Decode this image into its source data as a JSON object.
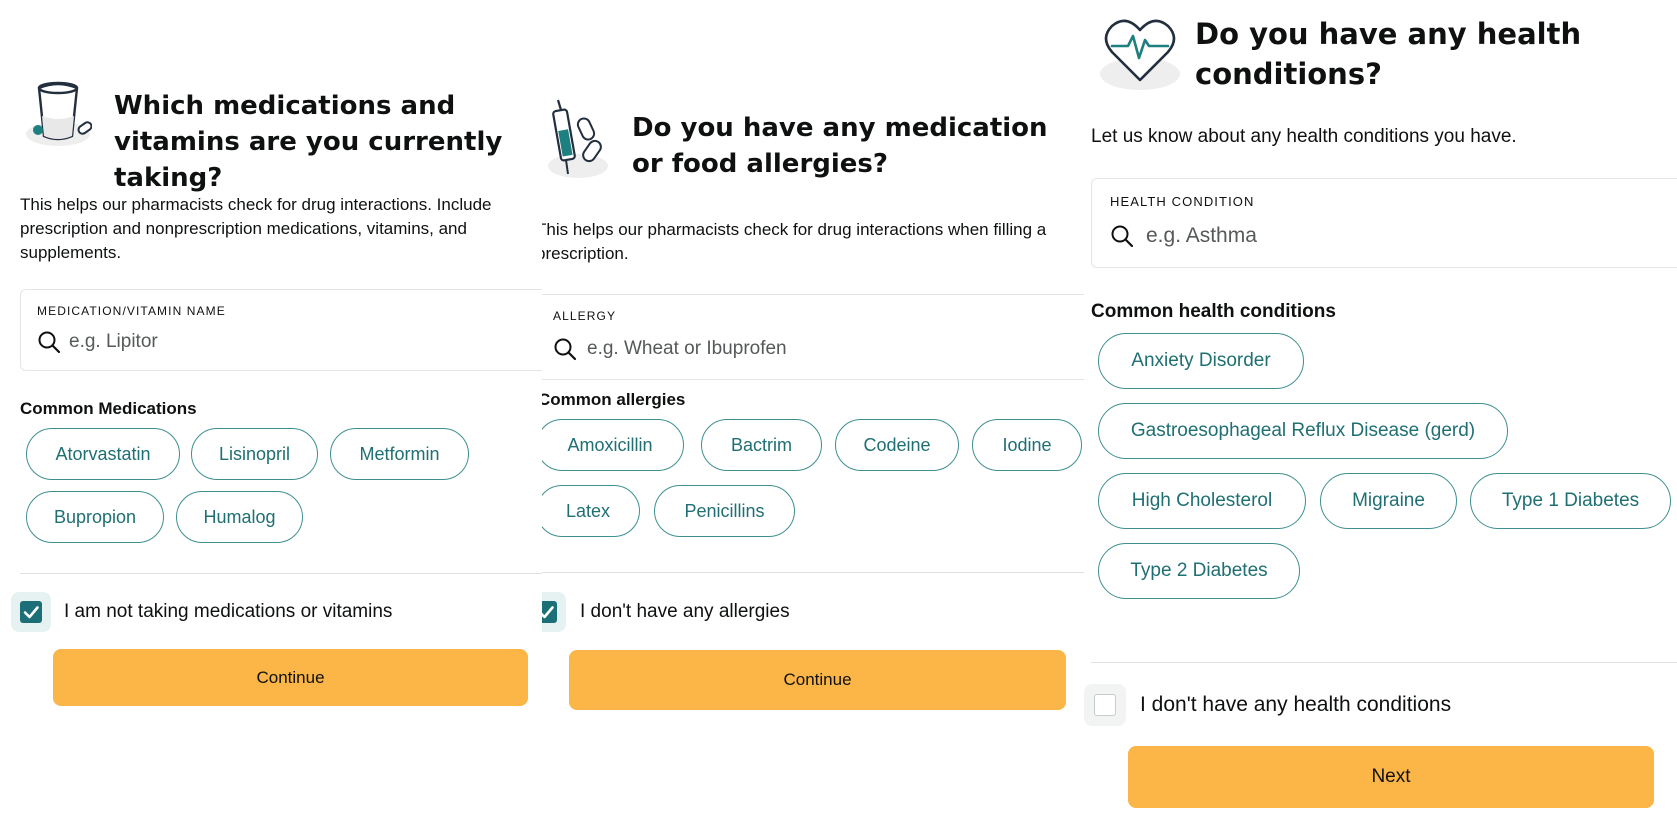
{
  "medications": {
    "title": "Which medications and vitamins are you currently taking?",
    "description": "This helps our pharmacists check for drug interactions. Include prescription and nonprescription medications, vitamins, and supplements.",
    "field_label": "MEDICATION/VITAMIN NAME",
    "placeholder": "e.g. Lipitor",
    "section_title": "Common Medications",
    "chips": [
      "Atorvastatin",
      "Lisinopril",
      "Metformin",
      "Bupropion",
      "Humalog"
    ],
    "checkbox_label": "I am not taking medications or vitamins",
    "checkbox_checked": true,
    "button_label": "Continue"
  },
  "allergies": {
    "title": "Do you have any medication or food allergies?",
    "description": "This helps our pharmacists check for drug interactions when filling a prescription.",
    "field_label": "ALLERGY",
    "placeholder": "e.g. Wheat or Ibuprofen",
    "section_title": "Common allergies",
    "chips": [
      "Amoxicillin",
      "Bactrim",
      "Codeine",
      "Iodine",
      "Latex",
      "Penicillins"
    ],
    "checkbox_label": "I don't have any allergies",
    "checkbox_checked": true,
    "button_label": "Continue"
  },
  "conditions": {
    "title": "Do you have any health conditions?",
    "description": "Let us know about any health conditions you have.",
    "field_label": "HEALTH CONDITION",
    "placeholder": "e.g. Asthma",
    "section_title": "Common health conditions",
    "chips": [
      "Anxiety Disorder",
      "Gastroesophageal Reflux Disease (gerd)",
      "High Cholesterol",
      "Migraine",
      "Type 1 Diabetes",
      "Type 2 Diabetes"
    ],
    "checkbox_label": "I don't have any health conditions",
    "checkbox_checked": false,
    "button_label": "Next"
  },
  "icons": {
    "medications": "glass-and-pill-icon",
    "allergies": "syringe-and-pills-icon",
    "conditions": "heart-pulse-icon",
    "search": "search-icon"
  },
  "colors": {
    "accent_teal": "#1d6f77",
    "chip_border": "#3f8f8f",
    "button_yellow": "#fcb547",
    "text": "#0f1111"
  }
}
